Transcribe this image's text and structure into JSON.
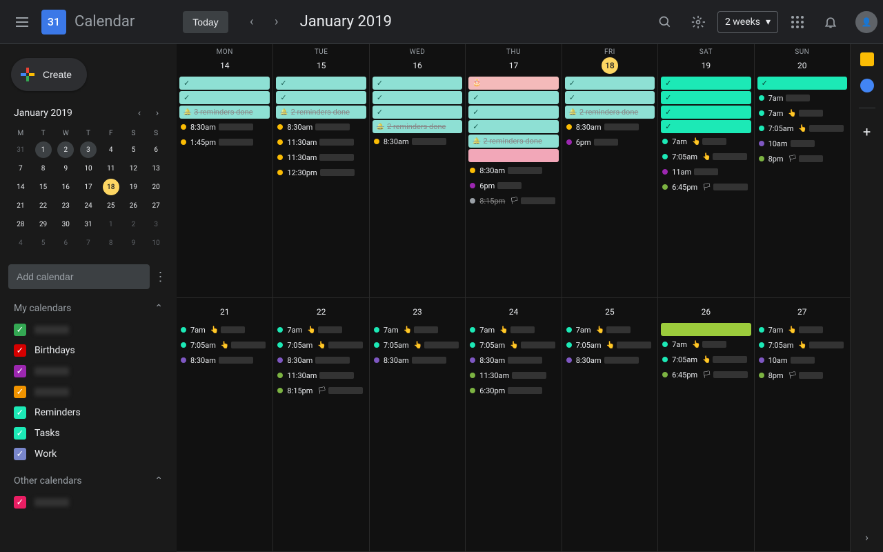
{
  "header": {
    "logo_day": "31",
    "app_name": "Calendar",
    "today_label": "Today",
    "current_period": "January 2019",
    "view_label": "2 weeks"
  },
  "sidebar": {
    "create_label": "Create",
    "mini_month": "January 2019",
    "mini_dow": [
      "M",
      "T",
      "W",
      "T",
      "F",
      "S",
      "S"
    ],
    "mini_days": [
      {
        "n": "31",
        "dim": true
      },
      {
        "n": "1",
        "sel": true
      },
      {
        "n": "2",
        "sel": true
      },
      {
        "n": "3",
        "sel": true
      },
      {
        "n": "4"
      },
      {
        "n": "5"
      },
      {
        "n": "6"
      },
      {
        "n": "7"
      },
      {
        "n": "8"
      },
      {
        "n": "9"
      },
      {
        "n": "10"
      },
      {
        "n": "11"
      },
      {
        "n": "12"
      },
      {
        "n": "13"
      },
      {
        "n": "14"
      },
      {
        "n": "15"
      },
      {
        "n": "16"
      },
      {
        "n": "17"
      },
      {
        "n": "18",
        "today": true
      },
      {
        "n": "19"
      },
      {
        "n": "20"
      },
      {
        "n": "21"
      },
      {
        "n": "22"
      },
      {
        "n": "23"
      },
      {
        "n": "24"
      },
      {
        "n": "25"
      },
      {
        "n": "26"
      },
      {
        "n": "27"
      },
      {
        "n": "28"
      },
      {
        "n": "29"
      },
      {
        "n": "30"
      },
      {
        "n": "31"
      },
      {
        "n": "1",
        "dim": true
      },
      {
        "n": "2",
        "dim": true
      },
      {
        "n": "3",
        "dim": true
      },
      {
        "n": "4",
        "dim": true
      },
      {
        "n": "5",
        "dim": true
      },
      {
        "n": "6",
        "dim": true
      },
      {
        "n": "7",
        "dim": true
      },
      {
        "n": "8",
        "dim": true
      },
      {
        "n": "9",
        "dim": true
      },
      {
        "n": "10",
        "dim": true
      }
    ],
    "add_calendar_placeholder": "Add calendar",
    "my_calendars_label": "My calendars",
    "my_calendars": [
      {
        "color": "#34a853",
        "label": "",
        "blur": true
      },
      {
        "color": "#d50000",
        "label": "Birthdays"
      },
      {
        "color": "#9c27b0",
        "label": "",
        "blur": true
      },
      {
        "color": "#f09300",
        "label": "",
        "blur": true
      },
      {
        "color": "#1ce9b6",
        "label": "Reminders"
      },
      {
        "color": "#1ce9b6",
        "label": "Tasks"
      },
      {
        "color": "#7986cb",
        "label": "Work"
      }
    ],
    "other_calendars_label": "Other calendars",
    "other_calendars": [
      {
        "color": "#e91e63",
        "label": "",
        "blur": true
      }
    ]
  },
  "grid": {
    "dow": [
      "MON",
      "TUE",
      "WED",
      "THU",
      "FRI",
      "SAT",
      "SUN"
    ],
    "weeks": [
      {
        "days": [
          {
            "num": "14",
            "blocks": [
              {
                "cls": "teal",
                "chk": true
              },
              {
                "cls": "teal",
                "chk": true
              },
              {
                "cls": "teal strike",
                "bell": true,
                "txt": "3 reminders done"
              }
            ],
            "dots": [
              {
                "c": "yellow",
                "t": "8:30am"
              },
              {
                "c": "yellow",
                "t": "1:45pm"
              }
            ]
          },
          {
            "num": "15",
            "blocks": [
              {
                "cls": "teal",
                "chk": true
              },
              {
                "cls": "teal",
                "chk": true
              },
              {
                "cls": "teal strike",
                "bell": true,
                "txt": "2 reminders done"
              }
            ],
            "dots": [
              {
                "c": "yellow",
                "t": "8:30am"
              },
              {
                "c": "yellow",
                "t": "11:30am"
              },
              {
                "c": "yellow",
                "t": "11:30am"
              },
              {
                "c": "yellow",
                "t": "12:30pm"
              }
            ]
          },
          {
            "num": "16",
            "blocks": [
              {
                "cls": "teal",
                "chk": true
              },
              {
                "cls": "teal",
                "chk": true
              },
              {
                "cls": "teal",
                "chk": true
              },
              {
                "cls": "teal strike",
                "bell": true,
                "txt": "2 reminders done"
              }
            ],
            "dots": [
              {
                "c": "yellow",
                "t": "8:30am"
              }
            ]
          },
          {
            "num": "17",
            "blocks": [
              {
                "cls": "pink",
                "cake": true
              },
              {
                "cls": "teal",
                "chk": true
              },
              {
                "cls": "teal",
                "chk": true
              },
              {
                "cls": "teal",
                "chk": true
              },
              {
                "cls": "teal strike",
                "bell": true,
                "txt": "2 reminders done"
              },
              {
                "cls": "pink-solid"
              }
            ],
            "dots": [
              {
                "c": "yellow",
                "t": "8:30am"
              },
              {
                "c": "purple",
                "t": "6pm"
              },
              {
                "c": "gray",
                "t": "8:15pm",
                "strike": true,
                "flag": true
              }
            ]
          },
          {
            "num": "18",
            "today": true,
            "blocks": [
              {
                "cls": "teal",
                "chk": true
              },
              {
                "cls": "teal",
                "chk": true
              },
              {
                "cls": "teal strike",
                "bell": true,
                "txt": "2 reminders done"
              }
            ],
            "dots": [
              {
                "c": "yellow",
                "t": "8:30am"
              },
              {
                "c": "purple",
                "t": "6pm"
              }
            ]
          },
          {
            "num": "19",
            "blocks": [
              {
                "cls": "teal-bright",
                "chk": true
              },
              {
                "cls": "teal-bright",
                "chk": true
              },
              {
                "cls": "teal-bright",
                "chk": true
              },
              {
                "cls": "teal-bright",
                "chk": true
              }
            ],
            "dots": [
              {
                "c": "teal",
                "t": "7am",
                "tap": true
              },
              {
                "c": "teal",
                "t": "7:05am",
                "tap": true
              },
              {
                "c": "purple",
                "t": "11am"
              },
              {
                "c": "lime",
                "t": "6:45pm",
                "flag": true
              }
            ]
          },
          {
            "num": "20",
            "blocks": [
              {
                "cls": "teal-bright",
                "chk": true
              }
            ],
            "dots": [
              {
                "c": "teal",
                "t": "7am"
              },
              {
                "c": "teal",
                "t": "7am",
                "tap": true
              },
              {
                "c": "teal",
                "t": "7:05am",
                "tap": true
              },
              {
                "c": "violet",
                "t": "10am"
              },
              {
                "c": "lime",
                "t": "8pm",
                "flag": true
              }
            ]
          }
        ]
      },
      {
        "days": [
          {
            "num": "21",
            "dots": [
              {
                "c": "teal",
                "t": "7am",
                "tap": true
              },
              {
                "c": "teal",
                "t": "7:05am",
                "tap": true
              },
              {
                "c": "violet",
                "t": "8:30am"
              }
            ]
          },
          {
            "num": "22",
            "dots": [
              {
                "c": "teal",
                "t": "7am",
                "tap": true
              },
              {
                "c": "teal",
                "t": "7:05am",
                "tap": true
              },
              {
                "c": "violet",
                "t": "8:30am"
              },
              {
                "c": "lime",
                "t": "11:30am"
              },
              {
                "c": "lime",
                "t": "8:15pm",
                "flag": true
              }
            ]
          },
          {
            "num": "23",
            "dots": [
              {
                "c": "teal",
                "t": "7am",
                "tap": true
              },
              {
                "c": "teal",
                "t": "7:05am",
                "tap": true
              },
              {
                "c": "violet",
                "t": "8:30am"
              }
            ]
          },
          {
            "num": "24",
            "dots": [
              {
                "c": "teal",
                "t": "7am",
                "tap": true
              },
              {
                "c": "teal",
                "t": "7:05am",
                "tap": true
              },
              {
                "c": "violet",
                "t": "8:30am"
              },
              {
                "c": "lime",
                "t": "11:30am"
              },
              {
                "c": "lime",
                "t": "6:30pm"
              }
            ]
          },
          {
            "num": "25",
            "dots": [
              {
                "c": "teal",
                "t": "7am",
                "tap": true
              },
              {
                "c": "teal",
                "t": "7:05am",
                "tap": true
              },
              {
                "c": "violet",
                "t": "8:30am"
              }
            ]
          },
          {
            "num": "26",
            "blocks": [
              {
                "cls": "green"
              }
            ],
            "dots": [
              {
                "c": "teal",
                "t": "7am",
                "tap": true
              },
              {
                "c": "teal",
                "t": "7:05am",
                "tap": true
              },
              {
                "c": "lime",
                "t": "6:45pm",
                "flag": true
              }
            ]
          },
          {
            "num": "27",
            "dots": [
              {
                "c": "teal",
                "t": "7am",
                "tap": true
              },
              {
                "c": "teal",
                "t": "7:05am",
                "tap": true
              },
              {
                "c": "violet",
                "t": "10am"
              },
              {
                "c": "lime",
                "t": "8pm",
                "flag": true
              }
            ]
          }
        ]
      }
    ]
  }
}
